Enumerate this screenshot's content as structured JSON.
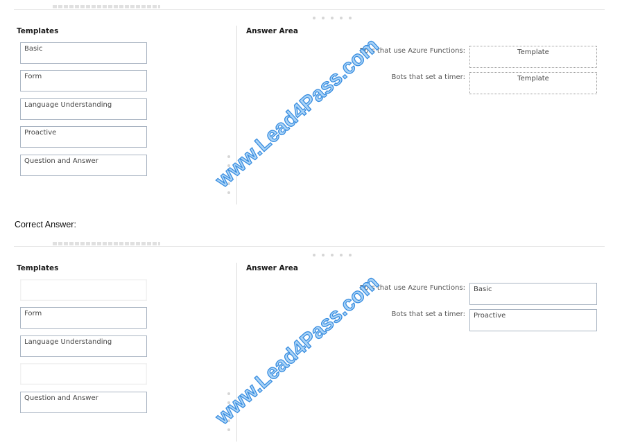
{
  "question": {
    "templates_title": "Templates",
    "answer_area_title": "Answer Area",
    "templates": [
      {
        "label": "Basic"
      },
      {
        "label": "Form"
      },
      {
        "label": "Language Understanding"
      },
      {
        "label": "Proactive"
      },
      {
        "label": "Question and Answer"
      }
    ],
    "answer_rows": [
      {
        "label": "Bots that use Azure Functions:",
        "value": "Template"
      },
      {
        "label": "Bots that set a timer:",
        "value": "Template"
      }
    ]
  },
  "correct_answer_label": "Correct Answer:",
  "answer": {
    "templates_title": "Templates",
    "answer_area_title": "Answer Area",
    "templates": [
      {
        "label": ""
      },
      {
        "label": "Form"
      },
      {
        "label": "Language Understanding"
      },
      {
        "label": ""
      },
      {
        "label": "Question and Answer"
      }
    ],
    "answer_rows": [
      {
        "label": "Bots that use Azure Functions:",
        "value": "Basic"
      },
      {
        "label": "Bots that set a timer:",
        "value": "Proactive"
      }
    ]
  },
  "watermark": "www.Lead4Pass.com"
}
